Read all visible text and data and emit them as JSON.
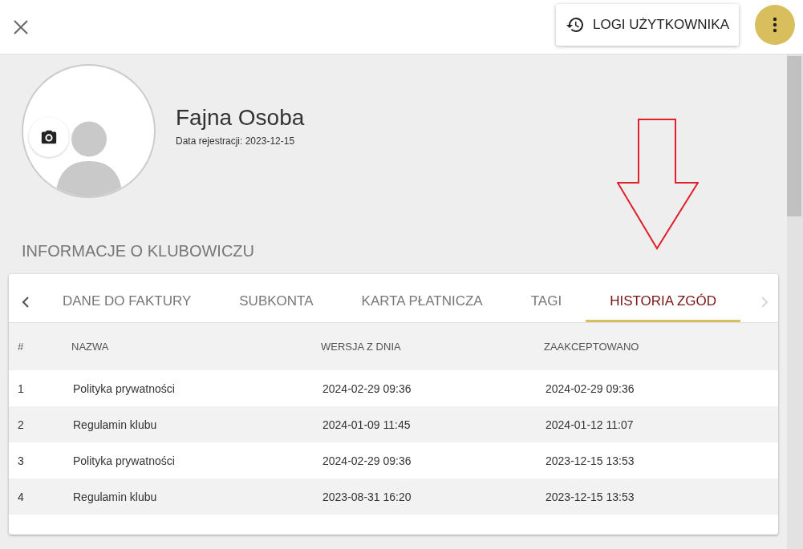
{
  "toolbar": {
    "logs_button": "LOGI UŻYTKOWNIKA"
  },
  "profile": {
    "name": "Fajna Osoba",
    "registration": "Data rejestracji: 2023-12-15"
  },
  "section_title": "INFORMACJE O KLUBOWICZU",
  "tabs": [
    {
      "label": "DANE DO FAKTURY",
      "selected": false
    },
    {
      "label": "SUBKONTA",
      "selected": false
    },
    {
      "label": "KARTA PŁATNICZA",
      "selected": false
    },
    {
      "label": "TAGI",
      "selected": false
    },
    {
      "label": "HISTORIA ZGÓD",
      "selected": true
    }
  ],
  "tab_scroll": {
    "left_disabled": false,
    "right_disabled": true
  },
  "table": {
    "columns": [
      "#",
      "NAZWA",
      "WERSJA Z DNIA",
      "ZAAKCEPTOWANO"
    ],
    "rows": [
      [
        "1",
        "Polityka prywatności",
        "2024-02-29 09:36",
        "2024-02-29 09:36"
      ],
      [
        "2",
        "Regulamin klubu",
        "2024-01-09 11:45",
        "2024-01-12 11:07"
      ],
      [
        "3",
        "Polityka prywatności",
        "2024-02-29 09:36",
        "2023-12-15 13:53"
      ],
      [
        "4",
        "Regulamin klubu",
        "2023-08-31 16:20",
        "2023-12-15 13:53"
      ]
    ]
  }
}
